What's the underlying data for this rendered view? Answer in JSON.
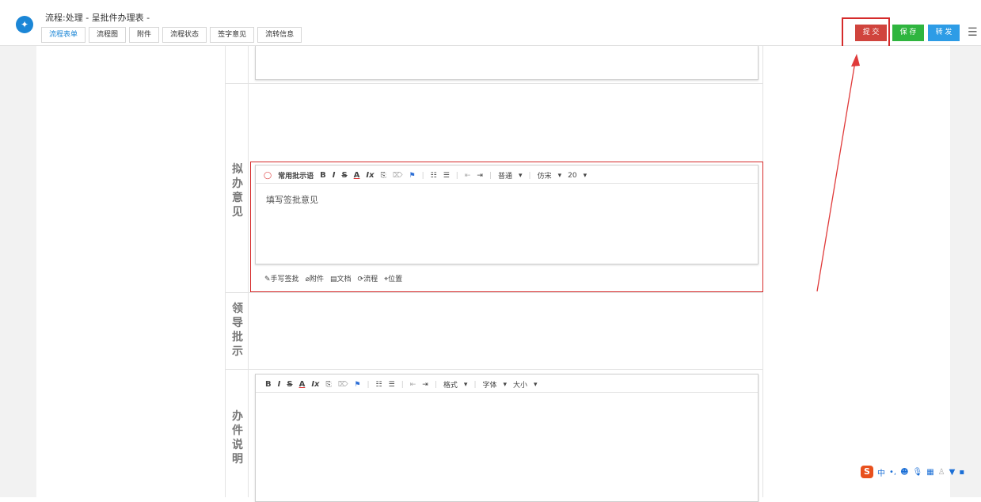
{
  "header": {
    "title": "流程:处理 - 呈批件办理表 -",
    "tabs": [
      "流程表单",
      "流程图",
      "附件",
      "流程状态",
      "签字意见",
      "流转信息"
    ],
    "buttons": {
      "submit": "提 交",
      "save": "保 存",
      "forward": "转 发"
    }
  },
  "form": {
    "labels": {
      "opinion": [
        "拟",
        "办",
        "意",
        "见"
      ],
      "leader": [
        "领",
        "导",
        "批",
        "示"
      ],
      "notes": [
        "办",
        "件",
        "说",
        "明"
      ]
    },
    "opinion_editor": {
      "toolbar_first": "常用批示语",
      "paragraph": "普通",
      "font": "仿宋",
      "size": "20",
      "text": "填写签批意见",
      "attachments": [
        "手写签批",
        "附件",
        "文档",
        "流程",
        "位置"
      ]
    },
    "notes_editor": {
      "paragraph": "格式",
      "font": "字体",
      "size": "大小"
    }
  },
  "ime": {
    "lang": "中"
  }
}
